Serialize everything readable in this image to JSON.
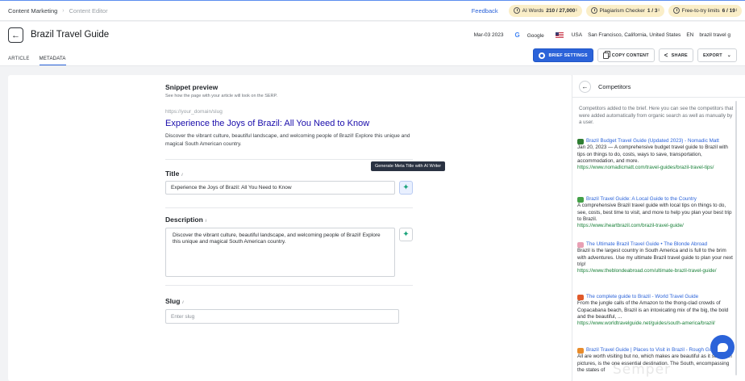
{
  "breadcrumb": {
    "items": [
      "Content Marketing",
      "Content Editor"
    ],
    "separator": "›"
  },
  "topbar": {
    "feedback": "Feedback",
    "ai_words": {
      "label": "AI Words",
      "value": "210 / 27,000"
    },
    "plagiarism": {
      "label": "Plagiarism Checker",
      "value": "1 / 3"
    },
    "free_try": {
      "label": "Free-to-try limits",
      "value": "6 / 19"
    },
    "info_glyph": "i"
  },
  "header": {
    "title": "Brazil Travel Guide",
    "date": "Mar-03 2023",
    "engine": "Google",
    "country": "USA",
    "location": "San Francisco, California, United States",
    "language": "EN",
    "keyword": "brazil travel g"
  },
  "tabs": [
    {
      "label": "ARTICLE"
    },
    {
      "label": "METADATA"
    }
  ],
  "actions": {
    "brief_settings": "BRIEF SETTINGS",
    "copy_content": "COPY CONTENT",
    "share": "SHARE",
    "export": "EXPORT"
  },
  "snippet": {
    "heading": "Snippet preview",
    "subtitle": "See how the page with your article will look on the SERP.",
    "url": "https://your_domain/slug",
    "title": "Experience the Joys of Brazil: All You Need to Know",
    "description": "Discover the vibrant culture, beautiful landscape, and welcoming people of Brazil! Explore this unique and magical South American country."
  },
  "fields": {
    "title_label": "Title",
    "title_value": "Experience the Joys of Brazil: All You Need to Know",
    "tooltip": "Generate Meta Title with AI Writer",
    "description_label": "Description",
    "description_value": "Discover the vibrant culture, beautiful landscape, and welcoming people of Brazil! Explore this unique and magical South American country.",
    "slug_label": "Slug",
    "slug_placeholder": "Enter slug"
  },
  "competitors": {
    "title": "Competitors",
    "description": "Competitors added to the brief. Here you can see the competitors that were added automatically from organic search as well as manually by a user.",
    "items": [
      {
        "title": "Brazil Budget Travel Guide (Updated 2023) - Nomadic Matt",
        "desc": "Jan 20, 2023 — A comprehensive budget travel guide to Brazil with tips on things to do, costs, ways to save, transportation, accommodation, and more.",
        "url": "https://www.nomadicmatt.com/travel-guides/brazil-travel-tips/",
        "color": "#2e7d32"
      },
      {
        "title": "Brazil Travel Guide: A Local Guide to the Country",
        "desc": "A comprehensive Brazil travel guide with local tips on things to do, see, costs, best time to visit, and more to help you plan your best trip to Brazil.",
        "url": "https://www.iheartbrazil.com/brazil-travel-guide/",
        "color": "#43a047"
      },
      {
        "title": "The Ultimate Brazil Travel Guide • The Blonde Abroad",
        "desc": "Brazil is the largest country in South America and is full to the brim with adventures. Use my ultimate Brazil travel guide to plan your next trip!",
        "url": "https://www.theblondeabroad.com/ultimate-brazil-travel-guide/",
        "color": "#e8a0b4"
      },
      {
        "title": "The complete guide to Brazil - World Travel Guide",
        "desc": "From the jungle calls of the Amazon to the thong-clad crowds of Copacabana beach, Brazil is an intoxicating mix of the big, the bold and the beautiful, ...",
        "url": "https://www.worldtravelguide.net/guides/south-america/brazil/",
        "color": "#e05a2b"
      },
      {
        "title": "Brazil Travel Guide | Places to Visit in Brazil - Rough Guides",
        "desc": "All are worth visiting but no, which makes are beautiful as it seems in pictures, is the one essential destination. The South, encompassing the states of",
        "url": "",
        "color": "#e88b2a"
      }
    ]
  },
  "watermark": "Semper"
}
